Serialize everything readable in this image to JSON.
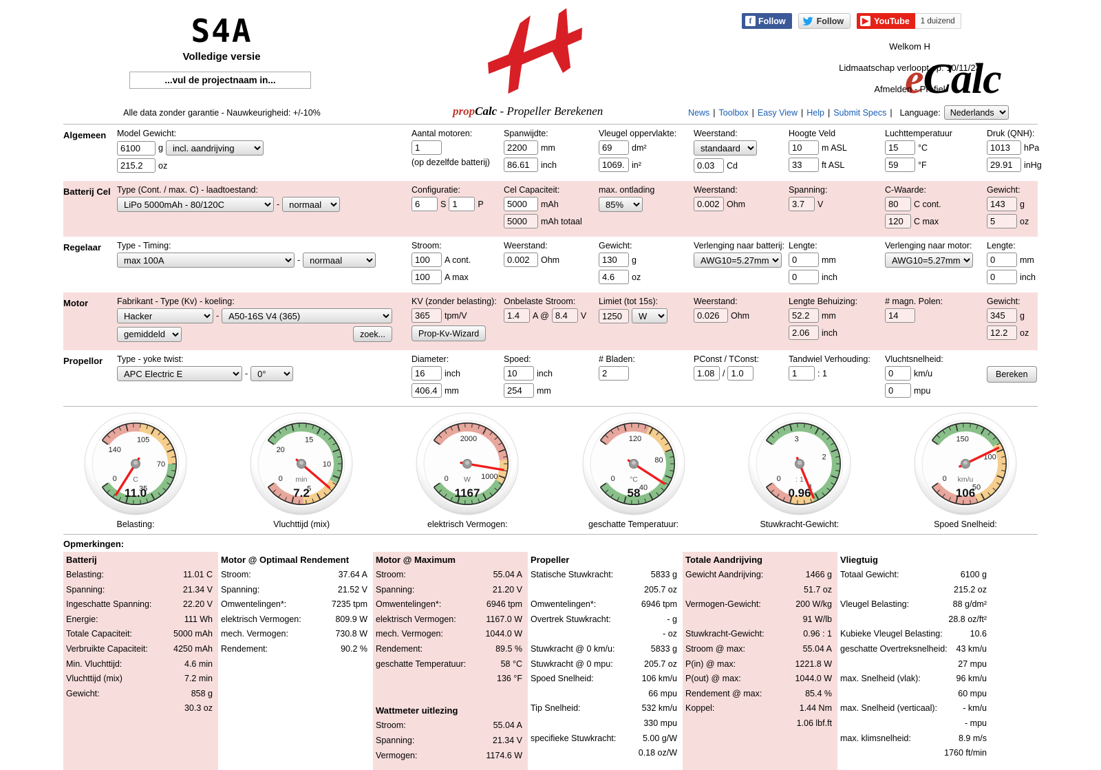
{
  "header": {
    "logo_text": "S4A",
    "logo_sub": "Volledige versie",
    "project_placeholder": "...vul de projectnaam in...",
    "disclaimer": "Alle data zonder garantie - Nauwkeurigheid: +/-10%",
    "brand": "eCalc",
    "brand_prefix": "e",
    "brand_rest": "Calc",
    "title_prefix": "prop",
    "title_bold": "Calc",
    "title_rest": " - Propeller Berekenen",
    "facebook_label": "Follow",
    "twitter_label": "Follow",
    "youtube_label": "YouTube",
    "youtube_count": "1 duizend",
    "welcome": "Welkom H",
    "membership": "Lidmaatschap verloopt op: 10/11/23",
    "account_links": "Afmelden - Profiel",
    "nav": [
      "News",
      "Toolbox",
      "Easy View",
      "Help",
      "Submit Specs"
    ],
    "language_label": "Language:",
    "language_value": "Nederlands"
  },
  "rows": {
    "algemeen": {
      "label": "Algemeen",
      "model_gewicht_label": "Model Gewicht:",
      "model_gewicht_g": "6100",
      "unit_g": "g",
      "incl_aandrijving": "incl. aandrijving",
      "model_gewicht_oz": "215.2",
      "unit_oz": "oz",
      "aantal_motoren_label": "Aantal motoren:",
      "aantal_motoren": "1",
      "zelfde_batterij": "(op dezelfde batterij)",
      "spanwijdte_label": "Spanwijdte:",
      "spanwijdte_mm": "2200",
      "unit_mm": "mm",
      "spanwijdte_inch": "86.61",
      "unit_inch": "inch",
      "vleugel_opp_label": "Vleugel oppervlakte:",
      "vleugel_dm2": "69",
      "unit_dm2": "dm²",
      "vleugel_in2": "1069.",
      "unit_in2": "in²",
      "weerstand_label": "Weerstand:",
      "weerstand_type": "standaard",
      "cd": "0.03",
      "unit_cd": "Cd",
      "hoogte_label": "Hoogte Veld",
      "hoogte_m": "10",
      "unit_masl": "m ASL",
      "hoogte_ft": "33",
      "unit_ftasl": "ft ASL",
      "temp_label": "Luchttemperatuur",
      "temp_c": "15",
      "unit_c": "°C",
      "temp_f": "59",
      "unit_f": "°F",
      "druk_label": "Druk (QNH):",
      "druk_hpa": "1013",
      "unit_hpa": "hPa",
      "druk_inhg": "29.91",
      "unit_inhg": "inHg"
    },
    "batterij": {
      "label": "Batterij Cel",
      "type_label": "Type (Cont. / max. C) - laadtoestand:",
      "type_value": "LiPo 5000mAh - 80/120C",
      "dash": "-",
      "laadtoestand": "normaal",
      "config_label": "Configuratie:",
      "cells_s": "6",
      "unit_s": "S",
      "cells_p": "1",
      "unit_p": "P",
      "capaciteit_label": "Cel Capaciteit:",
      "cap_mah": "5000",
      "unit_mah": "mAh",
      "cap_totaal": "5000",
      "unit_mah_totaal": "mAh totaal",
      "ontlading_label": "max. ontlading",
      "ontlading": "85%",
      "weerstand_label": "Weerstand:",
      "weerstand": "0.002",
      "unit_ohm": "Ohm",
      "spanning_label": "Spanning:",
      "spanning": "3.7",
      "unit_v": "V",
      "cwaarde_label": "C-Waarde:",
      "c_cont": "80",
      "unit_ccont": "C cont.",
      "c_max": "120",
      "unit_cmax": "C max",
      "gewicht_label": "Gewicht:",
      "gewicht_g": "143",
      "unit_g": "g",
      "gewicht_oz": "5",
      "unit_oz": "oz"
    },
    "regelaar": {
      "label": "Regelaar",
      "type_label": "Type - Timing:",
      "type_value": "max 100A",
      "dash": "-",
      "timing": "normaal",
      "stroom_label": "Stroom:",
      "a_cont": "100",
      "unit_acont": "A cont.",
      "a_max": "100",
      "unit_amax": "A max",
      "weerstand_label": "Weerstand:",
      "weerstand": "0.002",
      "unit_ohm": "Ohm",
      "gewicht_label": "Gewicht:",
      "gewicht_g": "130",
      "unit_g": "g",
      "gewicht_oz": "4.6",
      "unit_oz": "oz",
      "verl_batt_label": "Verlenging naar batterij:",
      "verl_batt": "AWG10=5.27mm²",
      "lengte_label": "Lengte:",
      "lengte_mm": "0",
      "unit_mm": "mm",
      "lengte_inch": "0",
      "unit_inch": "inch",
      "verl_motor_label": "Verlenging naar motor:",
      "verl_motor": "AWG10=5.27mm²",
      "lengte2_label": "Lengte:",
      "lengte2_mm": "0",
      "unit_mm2": "mm",
      "lengte2_inch": "0",
      "unit_inch2": "inch"
    },
    "motor": {
      "label": "Motor",
      "fabrikant_label": "Fabrikant - Type (Kv) - koeling:",
      "fabrikant": "Hacker",
      "dash": "-",
      "model": "A50-16S V4 (365)",
      "koeling": "gemiddeld",
      "zoek_button": "zoek...",
      "kv_label": "KV (zonder belasting):",
      "kv": "365",
      "unit_tpmv": "tpm/V",
      "wizard_button": "Prop-Kv-Wizard",
      "onbelast_label": "Onbelaste Stroom:",
      "onbelast_a": "1.4",
      "at": "A @",
      "onbelast_v": "8.4",
      "unit_v": "V",
      "limiet_label": "Limiet (tot 15s):",
      "limiet": "1250",
      "limiet_unit": "W",
      "weerstand_label": "Weerstand:",
      "weerstand": "0.026",
      "unit_ohm": "Ohm",
      "behuizing_label": "Lengte Behuizing:",
      "behuizing_mm": "52.2",
      "unit_mm": "mm",
      "behuizing_inch": "2.06",
      "unit_inch": "inch",
      "polen_label": "# magn. Polen:",
      "polen": "14",
      "gewicht_label": "Gewicht:",
      "gewicht_g": "345",
      "unit_g": "g",
      "gewicht_oz": "12.2",
      "unit_oz": "oz"
    },
    "propellor": {
      "label": "Propellor",
      "type_label": "Type - yoke twist:",
      "type_value": "APC Electric E",
      "dash": "-",
      "twist": "0°",
      "diameter_label": "Diameter:",
      "diam_inch": "16",
      "unit_inch": "inch",
      "diam_mm": "406.4",
      "unit_mm": "mm",
      "spoed_label": "Spoed:",
      "spoed_inch": "10",
      "unit_inch2": "inch",
      "spoed_mm": "254",
      "unit_mm2": "mm",
      "bladen_label": "# Bladen:",
      "bladen": "2",
      "const_label": "PConst / TConst:",
      "pconst": "1.08",
      "slash": "/",
      "tconst": "1.0",
      "tandwiel_label": "Tandwiel Verhouding:",
      "tandwiel": "1",
      "tandwiel_unit": ": 1",
      "vluchtsnelheid_label": "Vluchtsnelheid:",
      "snelheid_kmu": "0",
      "unit_kmu": "km/u",
      "snelheid_mpu": "0",
      "unit_mpu": "mpu",
      "bereken_button": "Bereken"
    }
  },
  "gauges": [
    {
      "name": "belasting",
      "caption": "Belasting:",
      "value": "11.0",
      "center_unit": "C",
      "ticks": [
        "0",
        "35",
        "70",
        "105",
        "140"
      ],
      "min": 0,
      "max": 140,
      "needle": 11.0,
      "bands": [
        {
          "from": 0,
          "to": 70,
          "color": "#89c089"
        },
        {
          "from": 70,
          "to": 110,
          "color": "#f5ce8e"
        },
        {
          "from": 110,
          "to": 140,
          "color": "#e8a79c"
        }
      ]
    },
    {
      "name": "vluchttijd",
      "caption": "Vluchttijd (mix)",
      "value": "7.2",
      "center_unit": "min",
      "ticks": [
        "0",
        "5",
        "10",
        "15",
        "20"
      ],
      "min": 0,
      "max": 20,
      "needle": 7.2,
      "bands": [
        {
          "from": 0,
          "to": 4,
          "color": "#e8a79c"
        },
        {
          "from": 4,
          "to": 8,
          "color": "#f5ce8e"
        },
        {
          "from": 8,
          "to": 20,
          "color": "#89c089"
        }
      ]
    },
    {
      "name": "vermogen",
      "caption": "elektrisch Vermogen:",
      "value": "1167",
      "center_unit": "W",
      "ticks": [
        "0",
        "1000",
        "2000"
      ],
      "min": 0,
      "max": 2500,
      "needle": 1167,
      "bands": [
        {
          "from": 0,
          "to": 1000,
          "color": "#89c089"
        },
        {
          "from": 1000,
          "to": 1300,
          "color": "#f5ce8e"
        },
        {
          "from": 1300,
          "to": 2500,
          "color": "#e8a79c"
        }
      ]
    },
    {
      "name": "temperatuur",
      "caption": "geschatte Temperatuur:",
      "value": "58",
      "center_unit": "°C",
      "ticks": [
        "0",
        "40",
        "80",
        "120"
      ],
      "min": 0,
      "max": 150,
      "needle": 58,
      "bands": [
        {
          "from": 0,
          "to": 85,
          "color": "#89c089"
        },
        {
          "from": 85,
          "to": 110,
          "color": "#f5ce8e"
        },
        {
          "from": 110,
          "to": 150,
          "color": "#e8a79c"
        }
      ]
    },
    {
      "name": "stuwkracht-gewicht",
      "caption": "Stuwkracht-Gewicht:",
      "value": "0.96",
      "center_unit": ": 1",
      "ticks": [
        "0",
        "1",
        "2",
        "3"
      ],
      "min": 0,
      "max": 3.6,
      "needle": 0.96,
      "bands": [
        {
          "from": 0,
          "to": 0.5,
          "color": "#e8a79c"
        },
        {
          "from": 0.5,
          "to": 0.95,
          "color": "#f5ce8e"
        },
        {
          "from": 0.95,
          "to": 3.6,
          "color": "#89c089"
        }
      ]
    },
    {
      "name": "spoed-snelheid",
      "caption": "Spoed Snelheid:",
      "value": "106",
      "center_unit": "km/u",
      "ticks": [
        "0",
        "50",
        "100",
        "150"
      ],
      "min": 0,
      "max": 180,
      "needle": 106,
      "bands": [
        {
          "from": 0,
          "to": 45,
          "color": "#e8a79c"
        },
        {
          "from": 45,
          "to": 110,
          "color": "#f5ce8e"
        },
        {
          "from": 110,
          "to": 180,
          "color": "#89c089"
        }
      ]
    }
  ],
  "results": {
    "opmerkingen": "Opmerkingen:",
    "columns": [
      {
        "title": "Batterij",
        "tinted": true,
        "rows": [
          {
            "key": "Belasting:",
            "val": "11.01 C"
          },
          {
            "key": "Spanning:",
            "val": "21.34 V"
          },
          {
            "key": "Ingeschatte Spanning:",
            "val": "22.20 V"
          },
          {
            "key": "Energie:",
            "val": "111 Wh"
          },
          {
            "key": "Totale Capaciteit:",
            "val": "5000 mAh"
          },
          {
            "key": "Verbruikte Capaciteit:",
            "val": "4250 mAh"
          },
          {
            "key": "Min. Vluchttijd:",
            "val": "4.6 min"
          },
          {
            "key": "Vluchttijd (mix)",
            "val": "7.2 min"
          },
          {
            "key": "Gewicht:",
            "val": "858 g"
          },
          {
            "key": "",
            "val": "30.3 oz"
          }
        ]
      },
      {
        "title": "Motor @ Optimaal Rendement",
        "tinted": false,
        "rows": [
          {
            "key": "Stroom:",
            "val": "37.64 A"
          },
          {
            "key": "Spanning:",
            "val": "21.52 V"
          },
          {
            "key": "Omwentelingen*:",
            "val": "7235 tpm"
          },
          {
            "key": "elektrisch Vermogen:",
            "val": "809.9 W"
          },
          {
            "key": "mech. Vermogen:",
            "val": "730.8 W"
          },
          {
            "key": "Rendement:",
            "val": "90.2 %"
          }
        ]
      },
      {
        "title": "Motor @ Maximum",
        "tinted": true,
        "rows": [
          {
            "key": "Stroom:",
            "val": "55.04 A"
          },
          {
            "key": "Spanning:",
            "val": "21.20 V"
          },
          {
            "key": "Omwentelingen*:",
            "val": "6946 tpm"
          },
          {
            "key": "elektrisch Vermogen:",
            "val": "1167.0 W"
          },
          {
            "key": "mech. Vermogen:",
            "val": "1044.0 W"
          },
          {
            "key": "Rendement:",
            "val": "89.5 %"
          },
          {
            "key": "geschatte Temperatuur:",
            "val": "58 °C"
          },
          {
            "key": "",
            "val": "136 °F"
          },
          {
            "key": "",
            "val": ""
          },
          {
            "key": "__HEAD__Wattmeter uitlezing",
            "val": ""
          },
          {
            "key": "Stroom:",
            "val": "55.04 A"
          },
          {
            "key": "Spanning:",
            "val": "21.34 V"
          },
          {
            "key": "Vermogen:",
            "val": "1174.6 W"
          }
        ]
      },
      {
        "title": "Propeller",
        "tinted": false,
        "rows": [
          {
            "key": "Statische Stuwkracht:",
            "val": "5833 g"
          },
          {
            "key": "",
            "val": "205.7 oz"
          },
          {
            "key": "Omwentelingen*:",
            "val": "6946 tpm"
          },
          {
            "key": "Overtrek Stuwkracht:",
            "val": "- g"
          },
          {
            "key": "",
            "val": "- oz"
          },
          {
            "key": "Stuwkracht @ 0 km/u:",
            "val": "5833 g"
          },
          {
            "key": "Stuwkracht @ 0 mpu:",
            "val": "205.7 oz"
          },
          {
            "key": "Spoed Snelheid:",
            "val": "106 km/u"
          },
          {
            "key": "",
            "val": "66 mpu"
          },
          {
            "key": "Tip Snelheid:",
            "val": "532 km/u"
          },
          {
            "key": "",
            "val": "330 mpu"
          },
          {
            "key": "specifieke Stuwkracht:",
            "val": "5.00 g/W"
          },
          {
            "key": "",
            "val": "0.18 oz/W"
          }
        ]
      },
      {
        "title": "Totale Aandrijving",
        "tinted": true,
        "rows": [
          {
            "key": "Gewicht Aandrijving:",
            "val": "1466 g"
          },
          {
            "key": "",
            "val": "51.7 oz"
          },
          {
            "key": "Vermogen-Gewicht:",
            "val": "200 W/kg"
          },
          {
            "key": "",
            "val": "91 W/lb"
          },
          {
            "key": "Stuwkracht-Gewicht:",
            "val": "0.96 : 1"
          },
          {
            "key": "Stroom @ max:",
            "val": "55.04 A"
          },
          {
            "key": "P(in) @ max:",
            "val": "1221.8 W"
          },
          {
            "key": "P(out) @ max:",
            "val": "1044.0 W"
          },
          {
            "key": "Rendement @ max:",
            "val": "85.4 %"
          },
          {
            "key": "Koppel:",
            "val": "1.44 Nm"
          },
          {
            "key": "",
            "val": "1.06 lbf.ft"
          }
        ]
      },
      {
        "title": "Vliegtuig",
        "tinted": false,
        "rows": [
          {
            "key": "Totaal Gewicht:",
            "val": "6100 g"
          },
          {
            "key": "",
            "val": "215.2 oz"
          },
          {
            "key": "Vleugel Belasting:",
            "val": "88 g/dm²"
          },
          {
            "key": "",
            "val": "28.8 oz/ft²"
          },
          {
            "key": "Kubieke Vleugel Belasting:",
            "val": "10.6"
          },
          {
            "key": "geschatte Overtreksnelheid:",
            "val": "43 km/u"
          },
          {
            "key": "",
            "val": "27 mpu"
          },
          {
            "key": "max. Snelheid (vlak):",
            "val": "96 km/u"
          },
          {
            "key": "",
            "val": "60 mpu"
          },
          {
            "key": "max. Snelheid (verticaal):",
            "val": "- km/u"
          },
          {
            "key": "",
            "val": "- mpu"
          },
          {
            "key": "max. klimsnelheid:",
            "val": "8.9 m/s"
          },
          {
            "key": "",
            "val": "1760 ft/min"
          }
        ]
      }
    ]
  }
}
